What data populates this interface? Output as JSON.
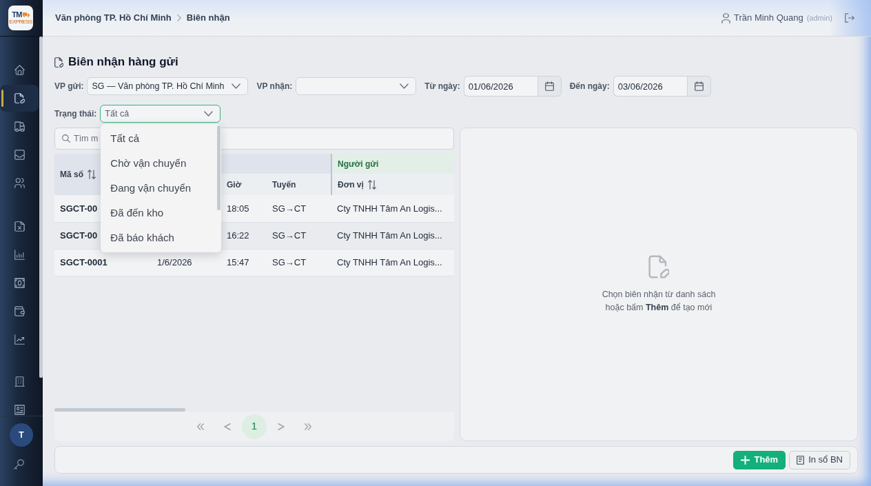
{
  "sidebar": {
    "logo": {
      "mark": "TM",
      "tagline": "EXPRESS"
    },
    "groups": [
      {
        "items": [
          {
            "selected": false
          },
          {
            "selected": true
          },
          {
            "selected": false
          },
          {
            "selected": false
          },
          {
            "selected": false
          }
        ]
      },
      {
        "items": [
          {
            "selected": false
          },
          {
            "selected": false
          },
          {
            "selected": false
          },
          {
            "selected": false
          },
          {
            "selected": false
          }
        ]
      },
      {
        "items": [
          {
            "selected": false
          },
          {
            "selected": false
          }
        ]
      }
    ],
    "avatar": {
      "initial": "T"
    }
  },
  "header": {
    "breadcrumb": [
      {
        "label": "Văn phòng TP. Hồ Chí Minh"
      },
      {
        "label": "Biên nhận"
      }
    ],
    "user": {
      "name": "Trần Minh Quang",
      "role": "(admin)"
    }
  },
  "page": {
    "title": "Biên nhận hàng gửi"
  },
  "filters": [
    {
      "kind": "select",
      "label": "VP gửi:",
      "value": "SG — Văn phòng TP. Hồ Chí Minh"
    },
    {
      "kind": "select",
      "label": "VP nhận:"
    },
    {
      "kind": "date",
      "label": "Từ ngày:",
      "value": "01/06/2026"
    },
    {
      "kind": "date",
      "label": "Đến ngày:",
      "value": "03/06/2026"
    }
  ],
  "status_filter": {
    "label": "Trạng thái:",
    "value": "Tất cả",
    "expanded": true,
    "options": [
      {
        "label": "Tất cả"
      },
      {
        "label": "Chờ vận chuyển"
      },
      {
        "label": "Đang vận chuyển"
      },
      {
        "label": "Đã đến kho"
      },
      {
        "label": "Đã báo khách"
      }
    ]
  },
  "search": {
    "placeholder": "Tìm m"
  },
  "table": {
    "sender_group": {
      "label": "Người gửi"
    },
    "columns": {
      "code": {
        "label": "Mã số",
        "sortable": true
      },
      "time": {
        "label": "Giờ",
        "sortable": false
      },
      "route": {
        "label": "Tuyến",
        "sortable": false
      },
      "sender_unit": {
        "label": "Đơn vị",
        "sortable": true
      }
    },
    "rows": [
      {
        "code": "SGCT-00",
        "time": "18:05",
        "route": "SG→CT",
        "sender_unit": "Cty TNHH Tâm An Logis..."
      },
      {
        "code": "SGCT-00",
        "time": "16:22",
        "route": "SG→CT",
        "sender_unit": "Cty TNHH Tâm An Logis..."
      },
      {
        "code": "SGCT-0001",
        "date": "1/6/2026",
        "time": "15:47",
        "route": "SG→CT",
        "sender_unit": "Cty TNHH Tâm An Logis..."
      }
    ]
  },
  "pagination": {
    "pages": [
      {
        "label": "1",
        "selected": true
      }
    ]
  },
  "detail_panel": {
    "message": "Chọn biên nhận từ danh sách hoặc bấm **Thêm** để tạo mới"
  },
  "actions": [
    {
      "kind": "primary",
      "label": "Thêm"
    },
    {
      "kind": "secondary",
      "label": "In sổ BN"
    }
  ]
}
